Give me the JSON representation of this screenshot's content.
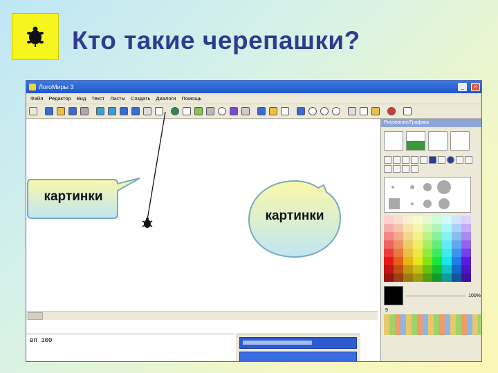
{
  "slide": {
    "title": "Кто такие черепашки?",
    "icon": "turtle-icon"
  },
  "window": {
    "title": "ЛогоМиры 3",
    "menu": [
      "Файл",
      "Редактор",
      "Вид",
      "Текст",
      "Листы",
      "Создать",
      "Диалоги",
      "Помощь"
    ],
    "command_text": "вп 100",
    "panel_title": "Рисование/Графика",
    "pen_width_label": "100%",
    "pen_index_label": "9"
  },
  "callouts": {
    "rect_label": "картинки",
    "oval_label": "картинки"
  },
  "colors": {
    "title": "#2f3b8f",
    "icon_bg": "#f6f51d",
    "callout_fill_top": "#fbf8a8",
    "callout_fill_bottom": "#bfe6f2"
  }
}
